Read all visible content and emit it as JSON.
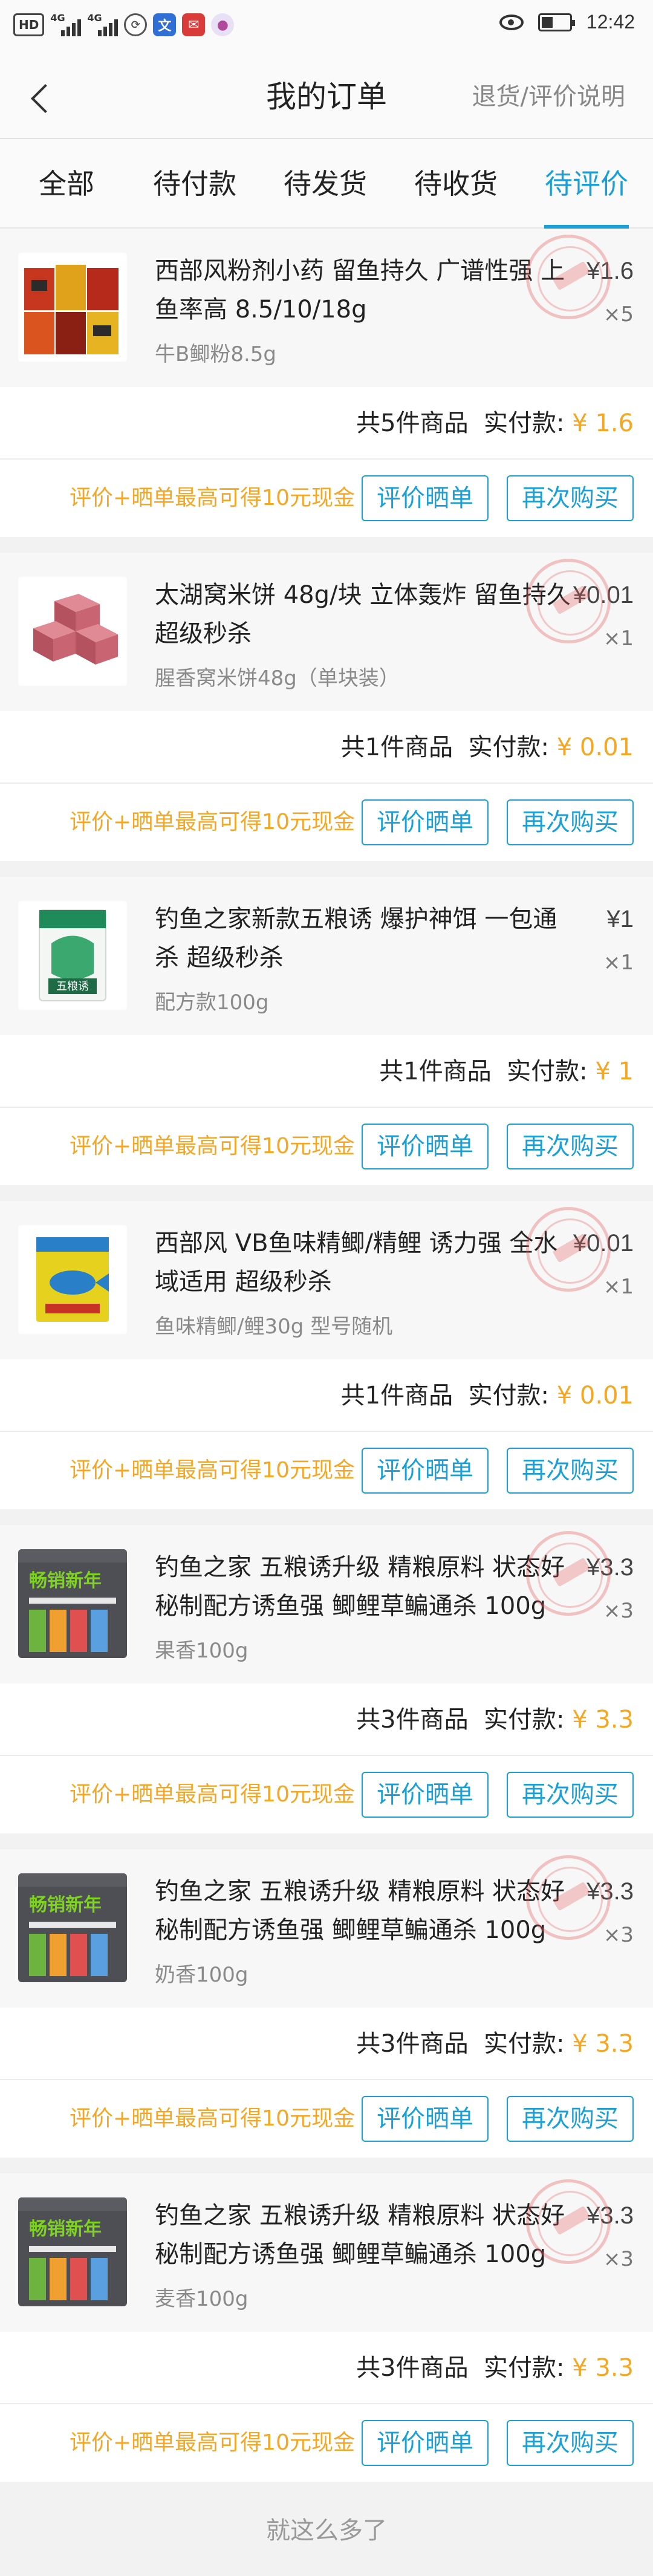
{
  "status_bar": {
    "network_tag": "HD",
    "signal1": "4G",
    "signal2": "4G",
    "time": "12:42"
  },
  "header": {
    "title": "我的订单",
    "right_link": "退货/评价说明"
  },
  "tabs": [
    {
      "label": "全部"
    },
    {
      "label": "待付款"
    },
    {
      "label": "待发货"
    },
    {
      "label": "待收货"
    },
    {
      "label": "待评价"
    }
  ],
  "orders": [
    {
      "title": "西部风粉剂小药 留鱼持久 广谱性强 上鱼率高 8.5/10/18g",
      "price": "¥1.6",
      "qty": "×5",
      "spec": "牛B鲫粉8.5g",
      "summary_count": "共5件商品",
      "summary_label": "实付款:",
      "summary_amount": "¥ 1.6",
      "promo": "评价+晒单最高可得10元现金",
      "review_btn": "评价晒单",
      "rebuy_btn": "再次购买"
    },
    {
      "title": "太湖窝米饼 48g/块 立体轰炸 留鱼持久 超级秒杀",
      "price": "¥0.01",
      "qty": "×1",
      "spec": "腥香窝米饼48g（单块装）",
      "summary_count": "共1件商品",
      "summary_label": "实付款:",
      "summary_amount": "¥ 0.01",
      "promo": "评价+晒单最高可得10元现金",
      "review_btn": "评价晒单",
      "rebuy_btn": "再次购买"
    },
    {
      "title": "钓鱼之家新款五粮诱 爆护神饵 一包通杀 超级秒杀",
      "price": "¥1",
      "qty": "×1",
      "spec": "配方款100g",
      "summary_count": "共1件商品",
      "summary_label": "实付款:",
      "summary_amount": "¥ 1",
      "promo": "评价+晒单最高可得10元现金",
      "review_btn": "评价晒单",
      "rebuy_btn": "再次购买"
    },
    {
      "title": "西部风 VB鱼味精鲫/精鲤 诱力强 全水域适用 超级秒杀",
      "price": "¥0.01",
      "qty": "×1",
      "spec": "鱼味精鲫/鲤30g 型号随机",
      "summary_count": "共1件商品",
      "summary_label": "实付款:",
      "summary_amount": "¥ 0.01",
      "promo": "评价+晒单最高可得10元现金",
      "review_btn": "评价晒单",
      "rebuy_btn": "再次购买"
    },
    {
      "title": "钓鱼之家 五粮诱升级 精粮原料 状态好 秘制配方诱鱼强 鲫鲤草鳊通杀 100g",
      "price": "¥3.3",
      "qty": "×3",
      "spec": "果香100g",
      "summary_count": "共3件商品",
      "summary_label": "实付款:",
      "summary_amount": "¥ 3.3",
      "promo": "评价+晒单最高可得10元现金",
      "review_btn": "评价晒单",
      "rebuy_btn": "再次购买"
    },
    {
      "title": "钓鱼之家 五粮诱升级 精粮原料 状态好 秘制配方诱鱼强 鲫鲤草鳊通杀 100g",
      "price": "¥3.3",
      "qty": "×3",
      "spec": "奶香100g",
      "summary_count": "共3件商品",
      "summary_label": "实付款:",
      "summary_amount": "¥ 3.3",
      "promo": "评价+晒单最高可得10元现金",
      "review_btn": "评价晒单",
      "rebuy_btn": "再次购买"
    },
    {
      "title": "钓鱼之家 五粮诱升级 精粮原料 状态好 秘制配方诱鱼强 鲫鲤草鳊通杀 100g",
      "price": "¥3.3",
      "qty": "×3",
      "spec": "麦香100g",
      "summary_count": "共3件商品",
      "summary_label": "实付款:",
      "summary_amount": "¥ 3.3",
      "promo": "评价+晒单最高可得10元现金",
      "review_btn": "评价晒单",
      "rebuy_btn": "再次购买"
    }
  ],
  "thumbnail_icons": [
    "powder-bait-packs-icon",
    "bait-cubes-icon",
    "wuliangyou-bag-icon",
    "fish-flavor-pack-icon",
    "wuliangyou-upgrade-icon",
    "wuliangyou-upgrade-icon",
    "wuliangyou-upgrade-icon"
  ],
  "thumbnail_labels": [
    "",
    "",
    "五粮诱",
    "",
    "畅销新年",
    "畅销新年",
    "畅销新年"
  ],
  "footer": "就这么多了",
  "colors": {
    "accent": "#1aa0d6",
    "price_orange": "#f5a623",
    "stamp": "#e65a5a"
  }
}
